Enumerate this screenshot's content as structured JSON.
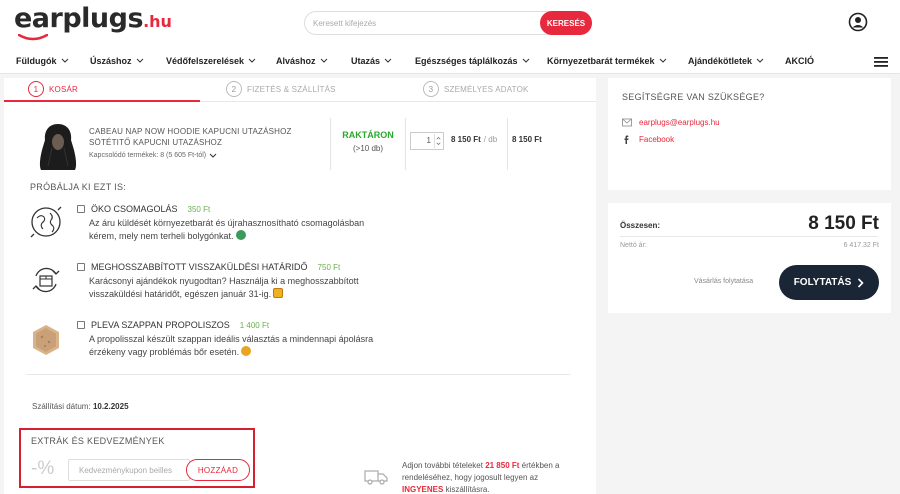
{
  "header": {
    "logo_text": "earplugs",
    "logo_tld": ".hu",
    "search_placeholder": "Keresett kifejezés",
    "search_button": "KERESÉS"
  },
  "nav": {
    "items": [
      "Füldugók",
      "Úszáshoz",
      "Védőfelszerelések",
      "Alváshoz",
      "Utazás",
      "Egészséges táplálkozás",
      "Környezetbarát termékek",
      "Ajándékötletek",
      "AKCIÓ"
    ]
  },
  "steps": [
    {
      "num": "1",
      "label": "KOSÁR"
    },
    {
      "num": "2",
      "label": "FIZETÉS & SZÁLLÍTÁS"
    },
    {
      "num": "3",
      "label": "SZEMÉLYES ADATOK"
    }
  ],
  "product": {
    "name_line1": "CABEAU NAP NOW HOODIE KAPUCNI UTAZÁSHOZ",
    "name_line2": "SÖTÉTITŐ KAPUCNI UTAZÁSHOZ",
    "related": "Kapcsolódó termékek: 8 (5 605 Ft-tól)",
    "stock_status": "RAKTÁRON",
    "stock_qty": "(>10 db)",
    "quantity": "1",
    "unit_price": "8 150 Ft",
    "unit_suffix": "/ db",
    "line_total": "8 150 Ft"
  },
  "try_title": "PRÓBÁLJA KI EZT IS:",
  "offers": [
    {
      "title": "ÖKO CSOMAGOLÁS",
      "price": "350 Ft",
      "desc_line1": "Az áru küldését környezetbarát és újrahasznosítható csomagolásban",
      "desc_line2": "kérem, mely nem terheli bolygónkat."
    },
    {
      "title": "MEGHOSSZABBÍTOTT VISSZAKÜLDÉSI HATÁRIDŐ",
      "price": "750 Ft",
      "desc_line1": "Karácsonyi ajándékok nyugodtan? Használja ki a meghosszabbított",
      "desc_line2": "visszaküldési határidőt, egészen január 31-ig."
    },
    {
      "title": "PLEVA SZAPPAN PROPOLISZOS",
      "price": "1 400 Ft",
      "desc_line1": "A propolisszal készült szappan ideális választás a mindennapi ápolásra",
      "desc_line2": "érzékeny vagy problémás bőr esetén."
    }
  ],
  "shipping": {
    "date_label": "Szállítási dátum:",
    "date_value": "10.2.2025"
  },
  "extras": {
    "title": "EXTRÁK ÉS KEDVEZMÉNYEK",
    "percent_symbol": "-%",
    "coupon_placeholder": "Kedvezménykupon beilles",
    "add_button": "HOZZÁAD"
  },
  "free_shipping": {
    "pre": "Adjon további tételeket",
    "amount": "21 850 Ft",
    "mid": "értékben a rendeléséhez, hogy jogosult legyen az",
    "free": "INGYENES",
    "post": "kiszállításra."
  },
  "help": {
    "title": "SEGÍTSÉGRE VAN SZÜKSÉGE?",
    "email": "earplugs@earplugs.hu",
    "facebook": "Facebook"
  },
  "summary": {
    "total_label": "Összesen:",
    "total_value": "8 150 Ft",
    "net_label": "Nettó ár:",
    "net_value": "6 417.32 Ft",
    "continue_shopping": "Vásárlás folytatása",
    "continue_button": "FOLYTATÁS"
  },
  "colors": {
    "brand_red": "#e8283c",
    "dark_button": "#1a2535",
    "price_green": "#6ab04c",
    "stock_green": "#2aa82a",
    "highlight_border": "#d7202f"
  }
}
